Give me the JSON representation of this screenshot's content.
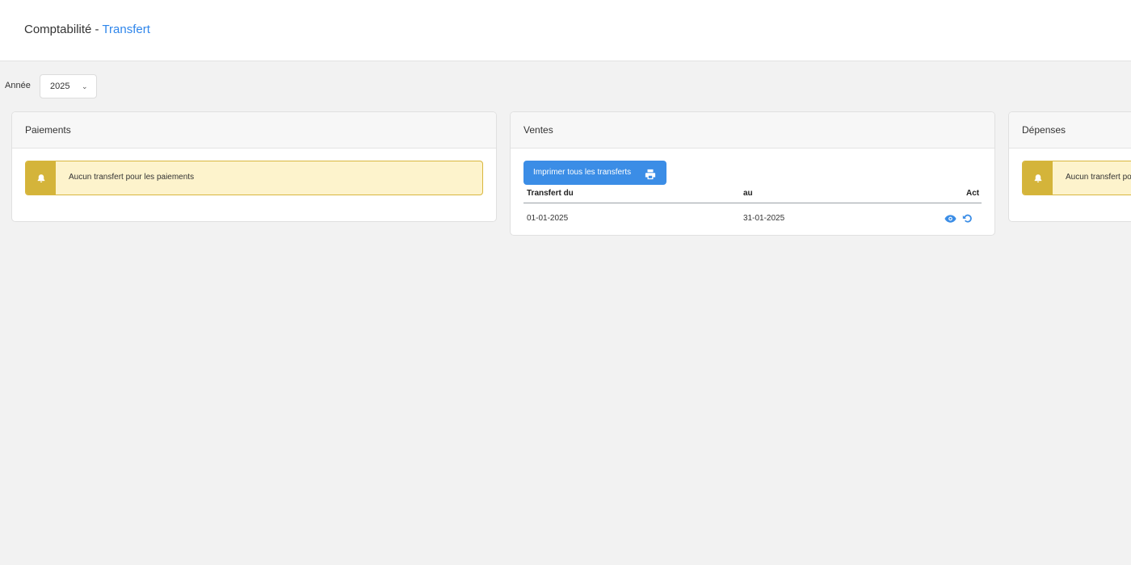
{
  "header": {
    "title_prefix": "Comptabilité",
    "separator": " - ",
    "title_accent": "Transfert"
  },
  "filter": {
    "label": "Année",
    "selected_year": "2025"
  },
  "cards": {
    "paiements": {
      "title": "Paiements",
      "alert_text": "Aucun transfert pour les paiements",
      "icon": "bell-icon"
    },
    "ventes": {
      "title": "Ventes",
      "print_button_label": "Imprimer tous les transferts",
      "print_icon": "printer-icon",
      "columns": {
        "from": "Transfert du",
        "to": "au",
        "actions": "Act"
      },
      "rows": [
        {
          "from": "01-01-2025",
          "to": "31-01-2025",
          "actions": [
            "eye-icon",
            "undo-icon"
          ]
        }
      ]
    },
    "depenses": {
      "title": "Dépenses",
      "alert_text": "Aucun transfert pour les dépenses",
      "icon": "bell-icon"
    }
  },
  "colors": {
    "accent": "#2f86eb",
    "button": "#3b8de6",
    "alert_bg": "#fdf3cc",
    "alert_icon_bg": "#d4b43a",
    "page_bg": "#f2f2f2"
  }
}
